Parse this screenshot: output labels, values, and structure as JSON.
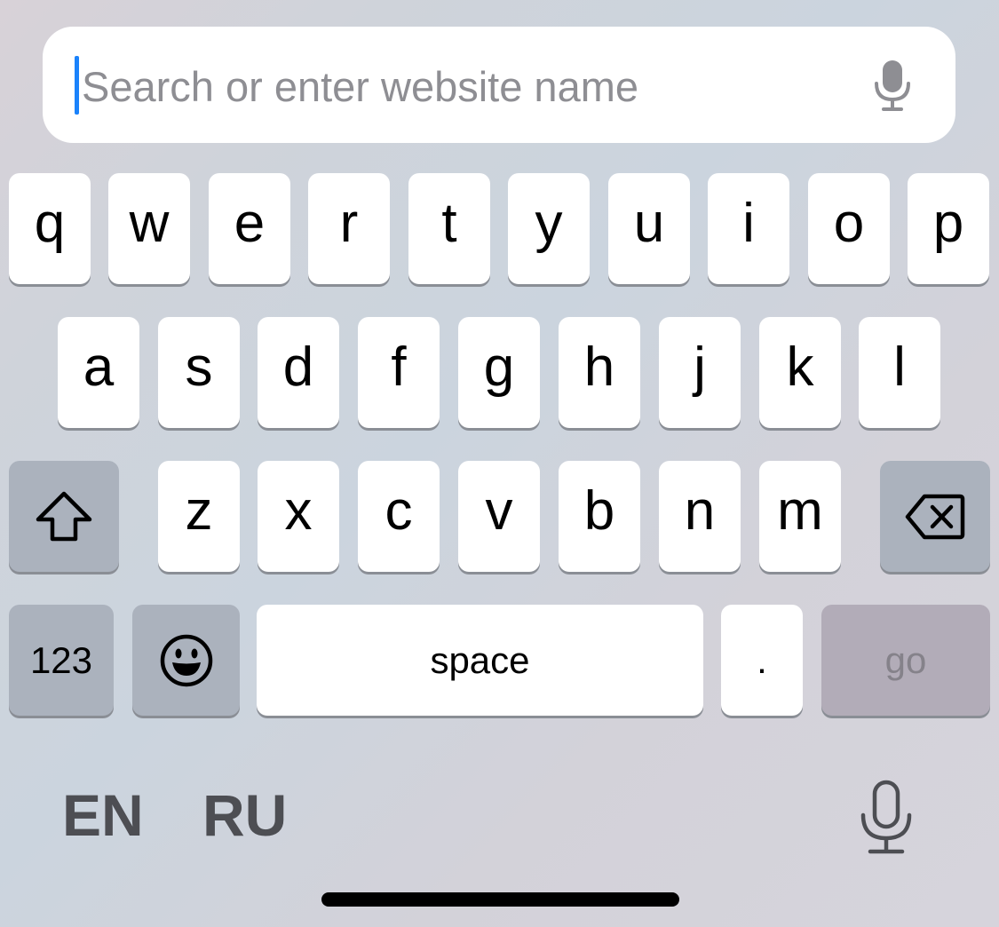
{
  "search": {
    "placeholder": "Search or enter website name",
    "value": ""
  },
  "keyboard": {
    "row1": [
      "q",
      "w",
      "e",
      "r",
      "t",
      "y",
      "u",
      "i",
      "o",
      "p"
    ],
    "row2": [
      "a",
      "s",
      "d",
      "f",
      "g",
      "h",
      "j",
      "k",
      "l"
    ],
    "row3": [
      "z",
      "x",
      "c",
      "v",
      "b",
      "n",
      "m"
    ],
    "numbers_label": "123",
    "space_label": "space",
    "period_label": ".",
    "go_label": "go",
    "icons": {
      "shift": "shift-icon",
      "delete": "delete-icon",
      "emoji": "emoji-icon",
      "mic": "microphone-icon"
    }
  },
  "languages": [
    "EN",
    "RU"
  ],
  "colors": {
    "caret": "#1a82fb",
    "key": "#ffffff",
    "function_key": "#abb2bd",
    "go_key": "#b2acb8"
  }
}
